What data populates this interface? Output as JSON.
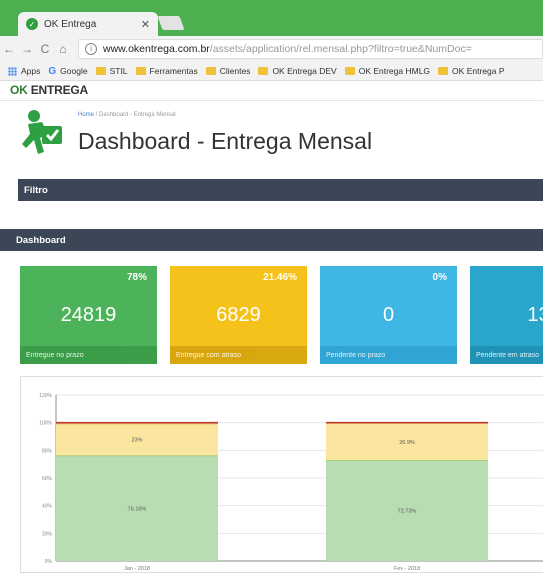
{
  "browser": {
    "tab_title": "OK Entrega",
    "tab_close": "✕",
    "url_host": "www.okentrega.com.br",
    "url_path": "/assets/application/rel.mensal.php?filtro=true&NumDoc=",
    "bookmarks": [
      "Apps",
      "Google",
      "STIL",
      "Ferramentas",
      "Clientes",
      "OK Entrega DEV",
      "OK Entrega HMLG",
      "OK Entrega P"
    ]
  },
  "brand": {
    "part1": "OK ",
    "part2": "ENTREGA"
  },
  "header": {
    "breadcrumb_home": "Home",
    "breadcrumb_sep": " / ",
    "breadcrumb_current": "Dashboard - Entrega Mensal",
    "title": "Dashboard - Entrega Mensal"
  },
  "sections": {
    "filtro": "Filtro",
    "dashboard": "Dashboard"
  },
  "cards": [
    {
      "pct": "78%",
      "value": "24819",
      "label": "Entregue no prazo",
      "color": "#4cb35a",
      "foot": "#3a9a47"
    },
    {
      "pct": "21.46%",
      "value": "6829",
      "label": "Entregue com atraso",
      "color": "#f4c21a",
      "foot": "#d4a30f"
    },
    {
      "pct": "0%",
      "value": "0",
      "label": "Pendente no prazo",
      "color": "#3fb6e4",
      "foot": "#2ea2cf"
    },
    {
      "pct": "",
      "value": "13",
      "label": "Pendente em atraso",
      "color": "#2aa5cc",
      "foot": "#1f8fb3"
    }
  ],
  "chart_data": {
    "type": "bar",
    "stacked": true,
    "categories": [
      "Jan - 2018",
      "Fev - 2018"
    ],
    "series": [
      {
        "values": [
          76.16,
          72.73
        ],
        "labels": [
          "76.16%",
          "72.73%"
        ],
        "color": "#b9ddb2",
        "stroke": "#62b25a"
      },
      {
        "values": [
          23.0,
          26.9
        ],
        "labels": [
          "23%",
          "26.9%"
        ],
        "color": "#fbe6a0",
        "stroke": "#e5c453"
      },
      {
        "values": [
          0.84,
          0.37
        ],
        "labels": [
          "",
          ""
        ],
        "color": "#f2b9a6",
        "stroke": "#c0392b"
      }
    ],
    "yticks": [
      "0%",
      "20%",
      "40%",
      "60%",
      "80%",
      "100%",
      "120%"
    ],
    "ylim": [
      0,
      120
    ],
    "grid": true
  }
}
